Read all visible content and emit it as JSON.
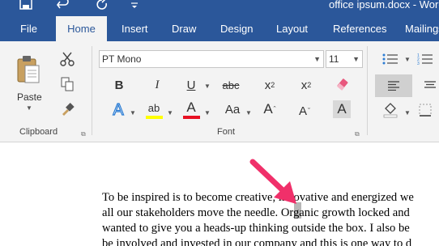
{
  "window": {
    "title": "office ipsum.docx - Word",
    "quick_access": [
      {
        "name": "save-icon",
        "glyph": "🖫"
      },
      {
        "name": "undo-icon",
        "glyph": "↶"
      },
      {
        "name": "redo-icon",
        "glyph": "↻"
      }
    ]
  },
  "tabs": [
    {
      "label": "File",
      "active": false
    },
    {
      "label": "Home",
      "active": true
    },
    {
      "label": "Insert",
      "active": false
    },
    {
      "label": "Draw",
      "active": false
    },
    {
      "label": "Design",
      "active": false
    },
    {
      "label": "Layout",
      "active": false
    },
    {
      "label": "References",
      "active": false
    },
    {
      "label": "Mailings",
      "active": false
    }
  ],
  "clipboard": {
    "paste_label": "Paste",
    "group_label": "Clipboard"
  },
  "font": {
    "family": "PT Mono",
    "size": "11",
    "group_label": "Font",
    "bold": "B",
    "italic": "I",
    "underline": "U",
    "strikethrough": "abc",
    "subscript": "x",
    "subscript_sub": "2",
    "superscript": "x",
    "superscript_sup": "2",
    "text_effects": "A",
    "highlight": "ab",
    "font_color": "A",
    "change_case": "Aa",
    "shading": "A",
    "highlight_color": "#ffff00",
    "font_color_value": "#e81123"
  },
  "colors": {
    "title_bar": "#2b579a",
    "ribbon": "#f3f3f3",
    "arrow": "#f0306a"
  },
  "document": {
    "lines": [
      "To be inspired is to become creative, innovative and energized we",
      "all our stakeholders move the needle. Organic growth locked and",
      "wanted to give you a heads-up thinking outside the box.  I also be",
      "be involved and invested in our company and this is one way to d"
    ]
  }
}
